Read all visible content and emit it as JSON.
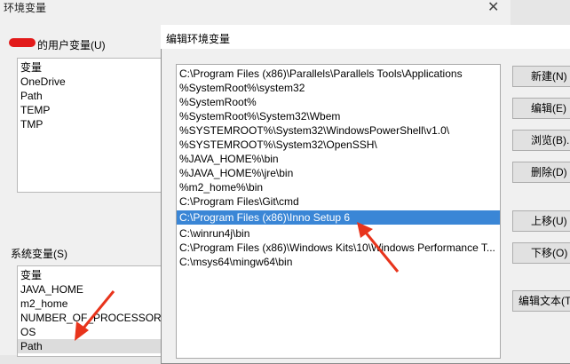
{
  "background_dialog": {
    "title": "环境变量",
    "close_glyph": "✕",
    "user_vars_label": "的用户变量(U)",
    "user_vars": [
      {
        "name": "变量"
      },
      {
        "name": "OneDrive"
      },
      {
        "name": "Path"
      },
      {
        "name": "TEMP"
      },
      {
        "name": "TMP"
      }
    ],
    "system_vars_label": "系统变量(S)",
    "system_vars": [
      {
        "name": "变量"
      },
      {
        "name": "JAVA_HOME"
      },
      {
        "name": "m2_home"
      },
      {
        "name": "NUMBER_OF_PROCESSORS"
      },
      {
        "name": "OS"
      },
      {
        "name": "Path"
      }
    ]
  },
  "edit_dialog": {
    "title": "编辑环境变量",
    "paths": [
      "C:\\Program Files (x86)\\Parallels\\Parallels Tools\\Applications",
      "%SystemRoot%\\system32",
      "%SystemRoot%",
      "%SystemRoot%\\System32\\Wbem",
      "%SYSTEMROOT%\\System32\\WindowsPowerShell\\v1.0\\",
      "%SYSTEMROOT%\\System32\\OpenSSH\\",
      "%JAVA_HOME%\\bin",
      "%JAVA_HOME%\\jre\\bin",
      "%m2_home%\\bin",
      "C:\\Program Files\\Git\\cmd",
      "C:\\Program Files (x86)\\Inno Setup 6",
      "C:\\winrun4j\\bin",
      "C:\\Program Files (x86)\\Windows Kits\\10\\Windows Performance T...",
      "C:\\msys64\\mingw64\\bin"
    ],
    "selected_index": 10,
    "buttons": {
      "new": "新建(N)",
      "edit": "编辑(E)",
      "browse": "浏览(B)...",
      "delete": "删除(D)",
      "move_up": "上移(U)",
      "move_down": "下移(O)",
      "edit_text": "编辑文本(T)..."
    }
  },
  "colors": {
    "selection": "#3a86d6",
    "annotation_arrow": "#e8341c",
    "redaction": "#e21a1a"
  }
}
